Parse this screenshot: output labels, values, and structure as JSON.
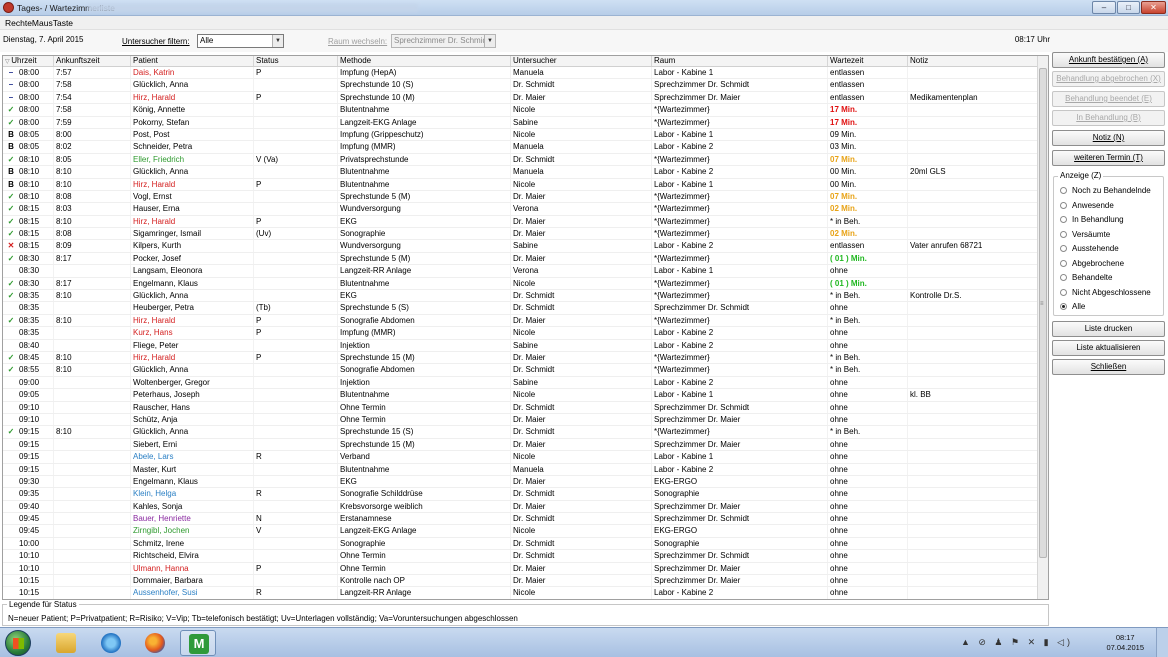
{
  "window": {
    "title": "Tages- / Wartezimmerliste",
    "buttons": [
      "–",
      "□",
      "✕"
    ]
  },
  "menubar": {
    "item": "RechteMausTaste"
  },
  "toolbar": {
    "date": "Dienstag, 7. April 2015",
    "filter_label": "Untersucher filtern:",
    "filter_value": "Alle",
    "room_label": "Raum wechseln:",
    "room_value": "Sprechzimmer Dr. Schmidt",
    "time": "08:17 Uhr"
  },
  "table": {
    "columns": [
      "Uhrzeit",
      "Ankunftszeit",
      "Patient",
      "Status",
      "Methode",
      "Untersucher",
      "Raum",
      "Wartezeit",
      "Notiz"
    ],
    "rows": [
      {
        "mark": "–",
        "mark_color": "#1a2a8a",
        "time": "08:00",
        "arrival": "7:57",
        "patient": "Dais, Katrin",
        "patient_color": "#d42020",
        "status": "P",
        "method": "Impfung (HepA)",
        "examiner": "Manuela",
        "room": "Labor - Kabine 1",
        "wait": "entlassen",
        "wait_color": "#000000",
        "note": ""
      },
      {
        "mark": "–",
        "mark_color": "#1a2a8a",
        "time": "08:00",
        "arrival": "7:58",
        "patient": "Glücklich, Anna",
        "patient_color": "#000000",
        "status": "",
        "method": "Sprechstunde 10 (S)",
        "examiner": "Dr. Schmidt",
        "room": "Sprechzimmer Dr. Schmidt",
        "wait": "entlassen",
        "wait_color": "#000000",
        "note": ""
      },
      {
        "mark": "–",
        "mark_color": "#1a2a8a",
        "time": "08:00",
        "arrival": "7:54",
        "patient": "Hirz, Harald",
        "patient_color": "#d42020",
        "status": "P",
        "method": "Sprechstunde 10 (M)",
        "examiner": "Dr. Maier",
        "room": "Sprechzimmer Dr. Maier",
        "wait": "entlassen",
        "wait_color": "#000000",
        "note": "Medikamentenplan"
      },
      {
        "mark": "✓",
        "mark_color": "#2e9a2e",
        "time": "08:00",
        "arrival": "7:58",
        "patient": "König, Annette",
        "patient_color": "#000000",
        "status": "",
        "method": "Blutentnahme",
        "examiner": "Nicole",
        "room": "*{Wartezimmer}",
        "wait": "17 Min.",
        "wait_color": "#e01010",
        "note": ""
      },
      {
        "mark": "✓",
        "mark_color": "#2e9a2e",
        "time": "08:00",
        "arrival": "7:59",
        "patient": "Pokorny, Stefan",
        "patient_color": "#000000",
        "status": "",
        "method": "Langzeit-EKG Anlage",
        "examiner": "Sabine",
        "room": "*{Wartezimmer}",
        "wait": "17 Min.",
        "wait_color": "#e01010",
        "note": ""
      },
      {
        "mark": "B",
        "mark_color": "#000000",
        "time": "08:05",
        "arrival": "8:00",
        "patient": "Post, Post",
        "patient_color": "#000000",
        "status": "",
        "method": "Impfung (Grippeschutz)",
        "examiner": "Nicole",
        "room": "Labor - Kabine 1",
        "wait": "09 Min.",
        "wait_color": "#000000",
        "note": ""
      },
      {
        "mark": "B",
        "mark_color": "#000000",
        "time": "08:05",
        "arrival": "8:02",
        "patient": "Schneider, Petra",
        "patient_color": "#000000",
        "status": "",
        "method": "Impfung (MMR)",
        "examiner": "Manuela",
        "room": "Labor - Kabine 2",
        "wait": "03 Min.",
        "wait_color": "#000000",
        "note": ""
      },
      {
        "mark": "✓",
        "mark_color": "#2e9a2e",
        "time": "08:10",
        "arrival": "8:05",
        "patient": "Eller, Friedrich",
        "patient_color": "#2e9a2e",
        "status": "V (Va)",
        "method": "Privatsprechstunde",
        "examiner": "Dr. Schmidt",
        "room": "*{Wartezimmer}",
        "wait": "07 Min.",
        "wait_color": "#e8a317",
        "note": ""
      },
      {
        "mark": "B",
        "mark_color": "#000000",
        "time": "08:10",
        "arrival": "8:10",
        "patient": "Glücklich, Anna",
        "patient_color": "#000000",
        "status": "",
        "method": "Blutentnahme",
        "examiner": "Manuela",
        "room": "Labor - Kabine 2",
        "wait": "00 Min.",
        "wait_color": "#000000",
        "note": "20ml GLS"
      },
      {
        "mark": "B",
        "mark_color": "#000000",
        "time": "08:10",
        "arrival": "8:10",
        "patient": "Hirz, Harald",
        "patient_color": "#d42020",
        "status": "P",
        "method": "Blutentnahme",
        "examiner": "Nicole",
        "room": "Labor - Kabine 1",
        "wait": "00 Min.",
        "wait_color": "#000000",
        "note": ""
      },
      {
        "mark": "✓",
        "mark_color": "#2e9a2e",
        "time": "08:10",
        "arrival": "8:08",
        "patient": "Vogl, Ernst",
        "patient_color": "#000000",
        "status": "",
        "method": "Sprechstunde 5 (M)",
        "examiner": "Dr. Maier",
        "room": "*{Wartezimmer}",
        "wait": "07 Min.",
        "wait_color": "#e8a317",
        "note": ""
      },
      {
        "mark": "✓",
        "mark_color": "#2e9a2e",
        "time": "08:15",
        "arrival": "8:03",
        "patient": "Hauser, Erna",
        "patient_color": "#000000",
        "status": "",
        "method": "Wundversorgung",
        "examiner": "Verona",
        "room": "*{Wartezimmer}",
        "wait": "02 Min.",
        "wait_color": "#e8a317",
        "note": ""
      },
      {
        "mark": "✓",
        "mark_color": "#2e9a2e",
        "time": "08:15",
        "arrival": "8:10",
        "patient": "Hirz, Harald",
        "patient_color": "#d42020",
        "status": "P",
        "method": "EKG",
        "examiner": "Dr. Maier",
        "room": "*{Wartezimmer}",
        "wait": "* in Beh.",
        "wait_color": "#000000",
        "note": ""
      },
      {
        "mark": "✓",
        "mark_color": "#2e9a2e",
        "time": "08:15",
        "arrival": "8:08",
        "patient": "Sigamringer, Ismail",
        "patient_color": "#000000",
        "status": "(Uv)",
        "method": "Sonographie",
        "examiner": "Dr. Maier",
        "room": "*{Wartezimmer}",
        "wait": "02 Min.",
        "wait_color": "#e8a317",
        "note": ""
      },
      {
        "mark": "✕",
        "mark_color": "#d42020",
        "time": "08:15",
        "arrival": "8:09",
        "patient": "Kilpers, Kurth",
        "patient_color": "#000000",
        "status": "",
        "method": "Wundversorgung",
        "examiner": "Sabine",
        "room": "Labor - Kabine 2",
        "wait": "entlassen",
        "wait_color": "#000000",
        "note": "Vater anrufen 68721"
      },
      {
        "mark": "✓",
        "mark_color": "#2e9a2e",
        "time": "08:30",
        "arrival": "8:17",
        "patient": "Pocker, Josef",
        "patient_color": "#000000",
        "status": "",
        "method": "Sprechstunde 5 (M)",
        "examiner": "Dr. Maier",
        "room": "*{Wartezimmer}",
        "wait": "( 01 ) Min.",
        "wait_color": "#22b822",
        "note": ""
      },
      {
        "mark": "",
        "mark_color": "#000000",
        "time": "08:30",
        "arrival": "",
        "patient": "Langsam, Eleonora",
        "patient_color": "#000000",
        "status": "",
        "method": "Langzeit-RR Anlage",
        "examiner": "Verona",
        "room": "Labor - Kabine 1",
        "wait": "ohne",
        "wait_color": "#000000",
        "note": ""
      },
      {
        "mark": "✓",
        "mark_color": "#2e9a2e",
        "time": "08:30",
        "arrival": "8:17",
        "patient": "Engelmann, Klaus",
        "patient_color": "#000000",
        "status": "",
        "method": "Blutentnahme",
        "examiner": "Nicole",
        "room": "*{Wartezimmer}",
        "wait": "( 01 ) Min.",
        "wait_color": "#22b822",
        "note": ""
      },
      {
        "mark": "✓",
        "mark_color": "#2e9a2e",
        "time": "08:35",
        "arrival": "8:10",
        "patient": "Glücklich, Anna",
        "patient_color": "#000000",
        "status": "",
        "method": "EKG",
        "examiner": "Dr. Schmidt",
        "room": "*{Wartezimmer}",
        "wait": "* in Beh.",
        "wait_color": "#000000",
        "note": "Kontrolle Dr.S."
      },
      {
        "mark": "",
        "mark_color": "#000000",
        "time": "08:35",
        "arrival": "",
        "patient": "Heuberger, Petra",
        "patient_color": "#000000",
        "status": "(Tb)",
        "method": "Sprechstunde 5 (S)",
        "examiner": "Dr. Schmidt",
        "room": "Sprechzimmer Dr. Schmidt",
        "wait": "ohne",
        "wait_color": "#000000",
        "note": ""
      },
      {
        "mark": "✓",
        "mark_color": "#2e9a2e",
        "time": "08:35",
        "arrival": "8:10",
        "patient": "Hirz, Harald",
        "patient_color": "#d42020",
        "status": "P",
        "method": "Sonografie Abdomen",
        "examiner": "Dr. Maier",
        "room": "*{Wartezimmer}",
        "wait": "* in Beh.",
        "wait_color": "#000000",
        "note": ""
      },
      {
        "mark": "",
        "mark_color": "#000000",
        "time": "08:35",
        "arrival": "",
        "patient": "Kurz, Hans",
        "patient_color": "#d42020",
        "status": "P",
        "method": "Impfung (MMR)",
        "examiner": "Nicole",
        "room": "Labor - Kabine 2",
        "wait": "ohne",
        "wait_color": "#000000",
        "note": ""
      },
      {
        "mark": "",
        "mark_color": "#000000",
        "time": "08:40",
        "arrival": "",
        "patient": "Fliege, Peter",
        "patient_color": "#000000",
        "status": "",
        "method": "Injektion",
        "examiner": "Sabine",
        "room": "Labor - Kabine 2",
        "wait": "ohne",
        "wait_color": "#000000",
        "note": ""
      },
      {
        "mark": "✓",
        "mark_color": "#2e9a2e",
        "time": "08:45",
        "arrival": "8:10",
        "patient": "Hirz, Harald",
        "patient_color": "#d42020",
        "status": "P",
        "method": "Sprechstunde 15 (M)",
        "examiner": "Dr. Maier",
        "room": "*{Wartezimmer}",
        "wait": "* in Beh.",
        "wait_color": "#000000",
        "note": ""
      },
      {
        "mark": "✓",
        "mark_color": "#2e9a2e",
        "time": "08:55",
        "arrival": "8:10",
        "patient": "Glücklich, Anna",
        "patient_color": "#000000",
        "status": "",
        "method": "Sonografie Abdomen",
        "examiner": "Dr. Schmidt",
        "room": "*{Wartezimmer}",
        "wait": "* in Beh.",
        "wait_color": "#000000",
        "note": ""
      },
      {
        "mark": "",
        "mark_color": "#000000",
        "time": "09:00",
        "arrival": "",
        "patient": "Woltenberger, Gregor",
        "patient_color": "#000000",
        "status": "",
        "method": "Injektion",
        "examiner": "Sabine",
        "room": "Labor - Kabine 2",
        "wait": "ohne",
        "wait_color": "#000000",
        "note": ""
      },
      {
        "mark": "",
        "mark_color": "#000000",
        "time": "09:05",
        "arrival": "",
        "patient": "Peterhaus, Joseph",
        "patient_color": "#000000",
        "status": "",
        "method": "Blutentnahme",
        "examiner": "Nicole",
        "room": "Labor - Kabine 1",
        "wait": "ohne",
        "wait_color": "#000000",
        "note": "kl. BB"
      },
      {
        "mark": "",
        "mark_color": "#000000",
        "time": "09:10",
        "arrival": "",
        "patient": "Rauscher, Hans",
        "patient_color": "#000000",
        "status": "",
        "method": "Ohne Termin",
        "examiner": "Dr. Schmidt",
        "room": "Sprechzimmer Dr. Schmidt",
        "wait": "ohne",
        "wait_color": "#000000",
        "note": ""
      },
      {
        "mark": "",
        "mark_color": "#000000",
        "time": "09:10",
        "arrival": "",
        "patient": "Schütz, Anja",
        "patient_color": "#000000",
        "status": "",
        "method": "Ohne Termin",
        "examiner": "Dr. Maier",
        "room": "Sprechzimmer Dr. Maier",
        "wait": "ohne",
        "wait_color": "#000000",
        "note": ""
      },
      {
        "mark": "✓",
        "mark_color": "#2e9a2e",
        "time": "09:15",
        "arrival": "8:10",
        "patient": "Glücklich, Anna",
        "patient_color": "#000000",
        "status": "",
        "method": "Sprechstunde 15 (S)",
        "examiner": "Dr. Schmidt",
        "room": "*{Wartezimmer}",
        "wait": "* in Beh.",
        "wait_color": "#000000",
        "note": ""
      },
      {
        "mark": "",
        "mark_color": "#000000",
        "time": "09:15",
        "arrival": "",
        "patient": "Siebert, Erni",
        "patient_color": "#000000",
        "status": "",
        "method": "Sprechstunde 15 (M)",
        "examiner": "Dr. Maier",
        "room": "Sprechzimmer Dr. Maier",
        "wait": "ohne",
        "wait_color": "#000000",
        "note": ""
      },
      {
        "mark": "",
        "mark_color": "#000000",
        "time": "09:15",
        "arrival": "",
        "patient": "Abele, Lars",
        "patient_color": "#2a7fc4",
        "status": "R",
        "method": "Verband",
        "examiner": "Nicole",
        "room": "Labor - Kabine 1",
        "wait": "ohne",
        "wait_color": "#000000",
        "note": ""
      },
      {
        "mark": "",
        "mark_color": "#000000",
        "time": "09:15",
        "arrival": "",
        "patient": "Master, Kurt",
        "patient_color": "#000000",
        "status": "",
        "method": "Blutentnahme",
        "examiner": "Manuela",
        "room": "Labor - Kabine 2",
        "wait": "ohne",
        "wait_color": "#000000",
        "note": ""
      },
      {
        "mark": "",
        "mark_color": "#000000",
        "time": "09:30",
        "arrival": "",
        "patient": "Engelmann, Klaus",
        "patient_color": "#000000",
        "status": "",
        "method": "EKG",
        "examiner": "Dr. Maier",
        "room": "EKG-ERGO",
        "wait": "ohne",
        "wait_color": "#000000",
        "note": ""
      },
      {
        "mark": "",
        "mark_color": "#000000",
        "time": "09:35",
        "arrival": "",
        "patient": "Klein, Helga",
        "patient_color": "#2a7fc4",
        "status": "R",
        "method": "Sonografie Schilddrüse",
        "examiner": "Dr. Schmidt",
        "room": "Sonographie",
        "wait": "ohne",
        "wait_color": "#000000",
        "note": ""
      },
      {
        "mark": "",
        "mark_color": "#000000",
        "time": "09:40",
        "arrival": "",
        "patient": "Kahles, Sonja",
        "patient_color": "#000000",
        "status": "",
        "method": "Krebsvorsorge weiblich",
        "examiner": "Dr. Maier",
        "room": "Sprechzimmer Dr. Maier",
        "wait": "ohne",
        "wait_color": "#000000",
        "note": ""
      },
      {
        "mark": "",
        "mark_color": "#000000",
        "time": "09:45",
        "arrival": "",
        "patient": "Bauer, Henriette",
        "patient_color": "#8a2aa0",
        "status": "N",
        "method": "Erstanamnese",
        "examiner": "Dr. Schmidt",
        "room": "Sprechzimmer Dr. Schmidt",
        "wait": "ohne",
        "wait_color": "#000000",
        "note": ""
      },
      {
        "mark": "",
        "mark_color": "#000000",
        "time": "09:45",
        "arrival": "",
        "patient": "Zirngibl, Jochen",
        "patient_color": "#2e9a2e",
        "status": "V",
        "method": "Langzeit-EKG Anlage",
        "examiner": "Nicole",
        "room": "EKG-ERGO",
        "wait": "ohne",
        "wait_color": "#000000",
        "note": ""
      },
      {
        "mark": "",
        "mark_color": "#000000",
        "time": "10:00",
        "arrival": "",
        "patient": "Schmitz, Irene",
        "patient_color": "#000000",
        "status": "",
        "method": "Sonographie",
        "examiner": "Dr. Schmidt",
        "room": "Sonographie",
        "wait": "ohne",
        "wait_color": "#000000",
        "note": ""
      },
      {
        "mark": "",
        "mark_color": "#000000",
        "time": "10:10",
        "arrival": "",
        "patient": "Richtscheid, Elvira",
        "patient_color": "#000000",
        "status": "",
        "method": "Ohne Termin",
        "examiner": "Dr. Schmidt",
        "room": "Sprechzimmer Dr. Schmidt",
        "wait": "ohne",
        "wait_color": "#000000",
        "note": ""
      },
      {
        "mark": "",
        "mark_color": "#000000",
        "time": "10:10",
        "arrival": "",
        "patient": "Ulmann, Hanna",
        "patient_color": "#d42020",
        "status": "P",
        "method": "Ohne Termin",
        "examiner": "Dr. Maier",
        "room": "Sprechzimmer Dr. Maier",
        "wait": "ohne",
        "wait_color": "#000000",
        "note": ""
      },
      {
        "mark": "",
        "mark_color": "#000000",
        "time": "10:15",
        "arrival": "",
        "patient": "Dornmaier, Barbara",
        "patient_color": "#000000",
        "status": "",
        "method": "Kontrolle nach OP",
        "examiner": "Dr. Maier",
        "room": "Sprechzimmer Dr. Maier",
        "wait": "ohne",
        "wait_color": "#000000",
        "note": ""
      },
      {
        "mark": "",
        "mark_color": "#000000",
        "time": "10:15",
        "arrival": "",
        "patient": "Aussenhofer, Susi",
        "patient_color": "#2a7fc4",
        "status": "R",
        "method": "Langzeit-RR Anlage",
        "examiner": "Nicole",
        "room": "Labor - Kabine 2",
        "wait": "ohne",
        "wait_color": "#000000",
        "note": ""
      }
    ]
  },
  "actions": {
    "arrival": "Ankunft bestätigen (A)",
    "aborted": "Behandlung abgebrochen (X)",
    "finished": "Behandlung beendet (E)",
    "in_treatment": "In Behandlung (B)",
    "note": "Notiz (N)",
    "next_appointment": "weiteren Termin (T)",
    "print": "Liste drucken",
    "refresh": "Liste aktualisieren",
    "close": "Schließen"
  },
  "display": {
    "title": "Anzeige (Z)",
    "options": [
      "Noch zu Behandelnde",
      "Anwesende",
      "In Behandlung",
      "Versäumte",
      "Ausstehende",
      "Abgebrochene",
      "Behandelte",
      "Nicht Abgeschlossene",
      "Alle"
    ],
    "selected": "Alle"
  },
  "legend": {
    "title": "Legende für Status",
    "text": "N=neuer Patient; P=Privatpatient; R=Risiko; V=Vip; Tb=telefonisch bestätigt; Uv=Unterlagen vollständig; Va=Voruntersuchungen abgeschlossen"
  },
  "taskbar": {
    "apps": [
      "windows-explorer",
      "internet-explorer",
      "firefox",
      "medical-app"
    ],
    "time": "08:17",
    "date": "07.04.2015"
  }
}
